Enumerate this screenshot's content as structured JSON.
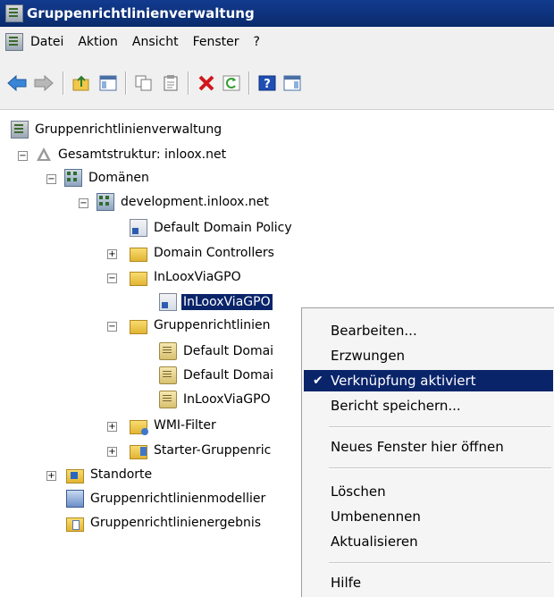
{
  "window": {
    "title": "Gruppenrichtlinienverwaltung"
  },
  "menu": [
    "Datei",
    "Aktion",
    "Ansicht",
    "Fenster",
    "?"
  ],
  "toolbar": {
    "buttons": [
      "back-arrow-icon",
      "forward-arrow-icon",
      "up-folder-icon",
      "show-hide-tree-icon",
      "copy-icon",
      "paste-icon",
      "delete-icon",
      "refresh-icon",
      "help-icon",
      "action-pane-icon"
    ]
  },
  "tree": {
    "root": "Gruppenrichtlinienverwaltung",
    "forest": "Gesamtstruktur: inloox.net",
    "domains": "Domänen",
    "domain": "development.inloox.net",
    "ddp": "Default Domain Policy",
    "dc": "Domain Controllers",
    "ou": "InLooxViaGPO",
    "ou_link": "InLooxViaGPO",
    "gpo_folder": "Gruppenrichtlinien",
    "gpo1": "Default Domai",
    "gpo2": "Default Domai",
    "gpo3": "InLooxViaGPO",
    "wmi": "WMI-Filter",
    "starter": "Starter-Gruppenric",
    "sites": "Standorte",
    "modeling": "Gruppenrichtlinienmodellier",
    "results": "Gruppenrichtlinienergebnis"
  },
  "context_menu": {
    "edit": "Bearbeiten...",
    "enforced": "Erzwungen",
    "link_enabled": "Verknüpfung aktiviert",
    "save_report": "Bericht speichern...",
    "new_window": "Neues Fenster hier öffnen",
    "delete": "Löschen",
    "rename": "Umbenennen",
    "refresh": "Aktualisieren",
    "help": "Hilfe",
    "checked_item": "link_enabled"
  },
  "colors": {
    "selection": "#0a246a",
    "titlebar": "#0a2a6b",
    "menu_bg": "#f0f0f0"
  }
}
